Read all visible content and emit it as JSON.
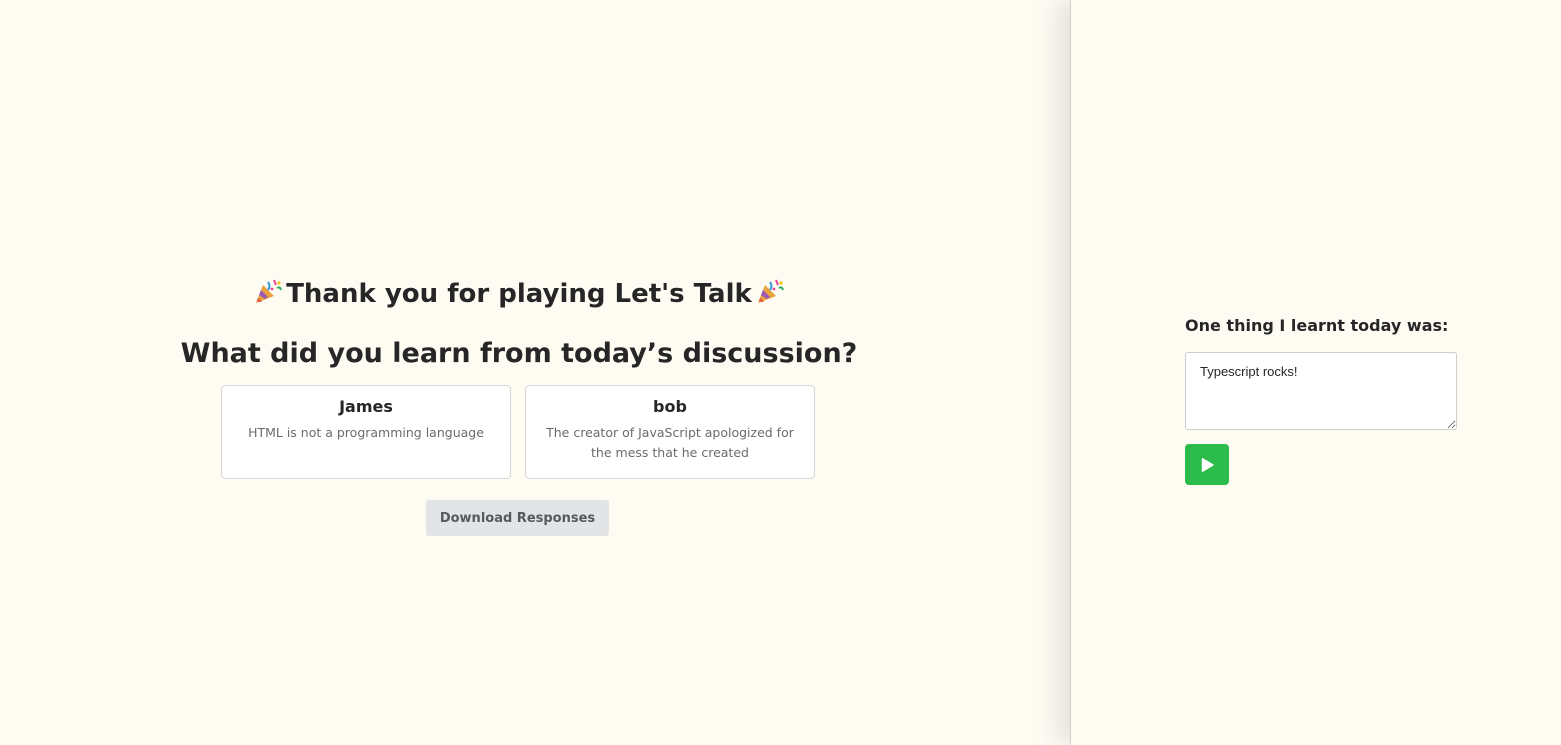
{
  "header": {
    "title": "Thank you for playing Let's Talk",
    "question": "What did you learn from today’s discussion?"
  },
  "icons": {
    "title_left": "party-popper-icon",
    "title_right": "party-popper-icon",
    "submit": "play-icon"
  },
  "responses": [
    {
      "name": "James",
      "text": "HTML is not a programming language"
    },
    {
      "name": "bob",
      "text": "The creator of JavaScript apologized for the mess that he created"
    }
  ],
  "actions": {
    "download_label": "Download Responses"
  },
  "side_panel": {
    "prompt": "One thing I learnt today was:",
    "input_value": "Typescript rocks!"
  },
  "colors": {
    "background": "#fefbf3",
    "submit_button": "#2bbb4a",
    "download_button": "#e2e4e6"
  }
}
